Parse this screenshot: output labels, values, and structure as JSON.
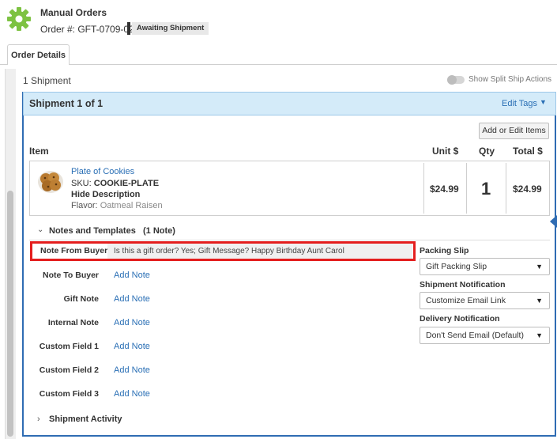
{
  "header": {
    "app_title": "Manual Orders",
    "order_number": "Order #: GFT-0709-02",
    "status_badge": "Awaiting Shipment",
    "icon": "gear-icon",
    "accent_color": "#7dc242"
  },
  "tabs": [
    {
      "label": "Order Details",
      "active": true
    }
  ],
  "shipments": {
    "count_label": "1 Shipment",
    "split_toggle_label": "Show Split Ship Actions",
    "split_toggle_on": false,
    "title": "Shipment 1 of 1",
    "edit_tags_label": "Edit Tags",
    "add_edit_items_label": "Add or Edit Items"
  },
  "items_table": {
    "headers": {
      "item": "Item",
      "unit": "Unit $",
      "qty": "Qty",
      "total": "Total $"
    },
    "rows": [
      {
        "name": "Plate of Cookies",
        "sku_label": "SKU:",
        "sku": "COOKIE-PLATE",
        "hide_description": "Hide Description",
        "flavor_label": "Flavor:",
        "flavor_value": "Oatmeal Raisen",
        "unit_price": "$24.99",
        "qty": "1",
        "total": "$24.99"
      }
    ]
  },
  "notes": {
    "section_title": "Notes and Templates",
    "section_count": "(1 Note)",
    "note_from_buyer_label": "Note From Buyer",
    "note_from_buyer_value": "Is this a gift order? Yes; Gift Message? Happy Birthday Aunt Carol",
    "fields": [
      {
        "label": "Note To Buyer",
        "link": "Add Note"
      },
      {
        "label": "Gift Note",
        "link": "Add Note"
      },
      {
        "label": "Internal Note",
        "link": "Add Note"
      },
      {
        "label": "Custom Field 1",
        "link": "Add Note"
      },
      {
        "label": "Custom Field 2",
        "link": "Add Note"
      },
      {
        "label": "Custom Field 3",
        "link": "Add Note"
      }
    ],
    "highlight_color": "#e41e1e"
  },
  "templates": {
    "packing_slip_label": "Packing Slip",
    "packing_slip_value": "Gift Packing Slip",
    "shipment_notification_label": "Shipment Notification",
    "shipment_notification_value": "Customize Email Link",
    "delivery_notification_label": "Delivery Notification",
    "delivery_notification_value": "Don't Send Email (Default)"
  },
  "activity": {
    "label": "Shipment Activity"
  }
}
